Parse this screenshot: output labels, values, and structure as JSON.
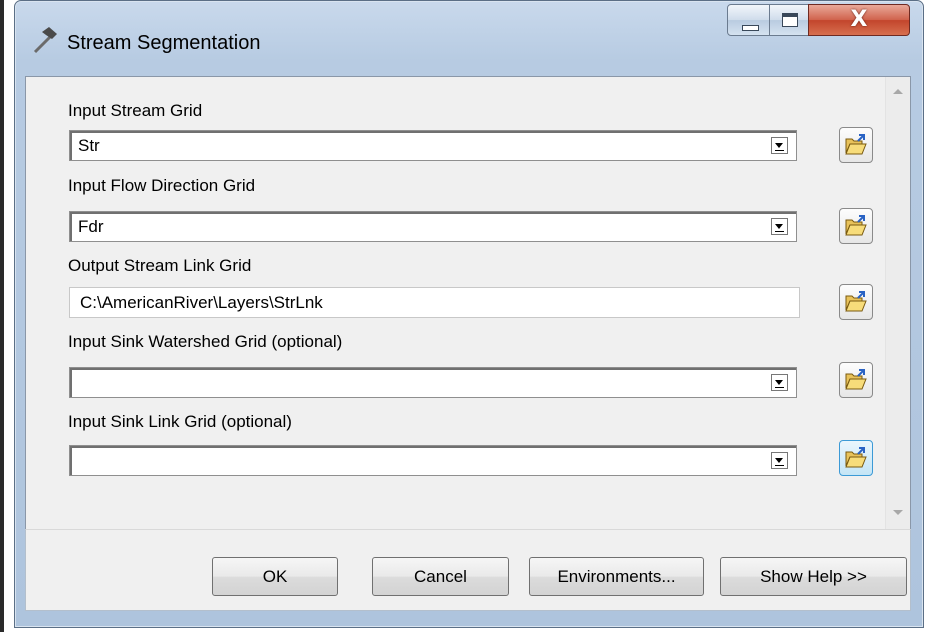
{
  "window": {
    "title": "Stream Segmentation",
    "minimize_icon": "minimize-icon",
    "maximize_icon": "maximize-icon",
    "close_label": "X"
  },
  "fields": [
    {
      "label": "Input Stream Grid",
      "value": "Str",
      "type": "combo"
    },
    {
      "label": "Input Flow Direction Grid",
      "value": "Fdr",
      "type": "combo"
    },
    {
      "label": "Output Stream Link Grid",
      "value": "C:\\AmericanRiver\\Layers\\StrLnk",
      "type": "text"
    },
    {
      "label": "Input Sink Watershed Grid (optional)",
      "value": "",
      "type": "combo"
    },
    {
      "label": "Input Sink Link Grid (optional)",
      "value": "",
      "type": "combo"
    }
  ],
  "buttons": {
    "ok": "OK",
    "cancel": "Cancel",
    "environments": "Environments...",
    "show_help": "Show Help >>"
  },
  "icons": {
    "title": "hammer-icon",
    "browse": "open-folder-icon"
  }
}
